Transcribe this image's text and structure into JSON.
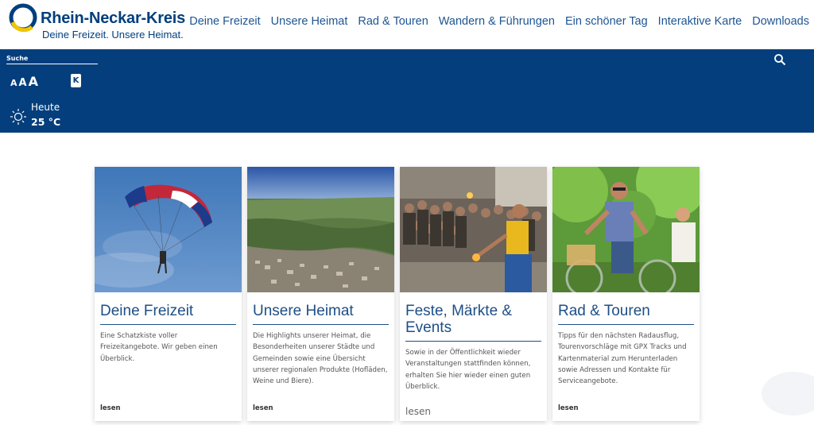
{
  "brand": {
    "title": "Rhein-Neckar-Kreis",
    "subtitle": "Deine Freizeit. Unsere Heimat."
  },
  "nav": [
    "Deine Freizeit",
    "Unsere Heimat",
    "Rad & Touren",
    "Wandern & Führungen",
    "Ein schöner Tag",
    "Interaktive Karte",
    "Downloads"
  ],
  "toolbar": {
    "search_label": "Suche",
    "font_small": "A",
    "font_medium": "A",
    "font_large": "A",
    "contrast_label": "K",
    "weather_label": "Heute",
    "weather_temp": "25 °C"
  },
  "cards": [
    {
      "title": "Deine Freizeit",
      "text": "Eine Schatzkiste voller Freizeitangebote. Wir geben einen Überblick.",
      "more": "lesen"
    },
    {
      "title": "Unsere Heimat",
      "text": "Die Highlights unserer Heimat, die Besonderheiten unserer Städte und Gemeinden sowie eine Übersicht unserer regionalen Produkte (Hofläden, Weine und Biere).",
      "more": "lesen"
    },
    {
      "title": "Feste, Märkte & Events",
      "text": "Sowie in der Öffentlichkeit wieder Veranstaltungen stattfinden können, erhalten Sie hier wieder einen guten Überblick.",
      "more": "lesen"
    },
    {
      "title": "Rad & Touren",
      "text": "Tipps für den nächsten Radausflug, Tourenvorschläge mit GPX Tracks und Kartenmaterial zum Herunterladen sowie Adressen und Kontakte für Serviceangebote.",
      "more": "lesen"
    }
  ],
  "colors": {
    "brand_blue": "#043e7c",
    "link_blue": "#1d5593",
    "ring_yellow": "#f2c500"
  },
  "icons": {
    "search": "search-icon",
    "weather": "sun-icon",
    "logo": "logo-ring-icon"
  }
}
